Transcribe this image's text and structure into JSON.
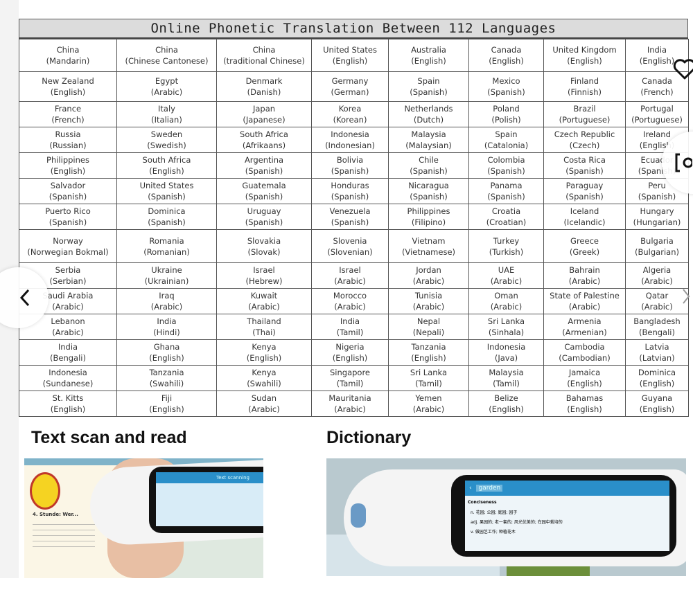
{
  "table": {
    "title": "Online Phonetic Translation Between 112 Languages",
    "rows": [
      [
        [
          "China",
          "(Mandarin)"
        ],
        [
          "China",
          "(Chinese Cantonese)"
        ],
        [
          "China",
          "(traditional Chinese)"
        ],
        [
          "United States",
          "(English)"
        ],
        [
          "Australia",
          "(English)"
        ],
        [
          "Canada",
          "(English)"
        ],
        [
          "United Kingdom",
          "(English)"
        ],
        [
          "India",
          "(English)"
        ]
      ],
      [
        [
          "New Zealand",
          "(English)"
        ],
        [
          "Egypt",
          "(Arabic)"
        ],
        [
          "Denmark",
          "(Danish)"
        ],
        [
          "Germany",
          "(German)"
        ],
        [
          "Spain",
          "(Spanish)"
        ],
        [
          "Mexico",
          "(Spanish)"
        ],
        [
          "Finland",
          "(Finnish)"
        ],
        [
          "Canada",
          "(French)"
        ]
      ],
      [
        [
          "France",
          "(French)"
        ],
        [
          "Italy",
          "(Italian)"
        ],
        [
          "Japan",
          "(Japanese)"
        ],
        [
          "Korea",
          "(Korean)"
        ],
        [
          "Netherlands",
          "(Dutch)"
        ],
        [
          "Poland",
          "(Polish)"
        ],
        [
          "Brazil",
          "(Portuguese)"
        ],
        [
          "Portugal",
          "(Portuguese)"
        ]
      ],
      [
        [
          "Russia",
          "(Russian)"
        ],
        [
          "Sweden",
          "(Swedish)"
        ],
        [
          "South Africa",
          "(Afrikaans)"
        ],
        [
          "Indonesia",
          "(Indonesian)"
        ],
        [
          "Malaysia",
          "(Malaysian)"
        ],
        [
          "Spain",
          "(Catalonia)"
        ],
        [
          "Czech Republic",
          "(Czech)"
        ],
        [
          "Ireland",
          "(English)"
        ]
      ],
      [
        [
          "Philippines",
          "(English)"
        ],
        [
          "South Africa",
          "(English)"
        ],
        [
          "Argentina",
          "(Spanish)"
        ],
        [
          "Bolivia",
          "(Spanish)"
        ],
        [
          "Chile",
          "(Spanish)"
        ],
        [
          "Colombia",
          "(Spanish)"
        ],
        [
          "Costa Rica",
          "(Spanish)"
        ],
        [
          "Ecuador",
          "(Spanish)"
        ]
      ],
      [
        [
          "Salvador",
          "(Spanish)"
        ],
        [
          "United States",
          "(Spanish)"
        ],
        [
          "Guatemala",
          "(Spanish)"
        ],
        [
          "Honduras",
          "(Spanish)"
        ],
        [
          "Nicaragua",
          "(Spanish)"
        ],
        [
          "Panama",
          "(Spanish)"
        ],
        [
          "Paraguay",
          "(Spanish)"
        ],
        [
          "Peru",
          "(Spanish)"
        ]
      ],
      [
        [
          "Puerto Rico",
          "(Spanish)"
        ],
        [
          "Dominica",
          "(Spanish)"
        ],
        [
          "Uruguay",
          "(Spanish)"
        ],
        [
          "Venezuela",
          "(Spanish)"
        ],
        [
          "Philippines",
          "(Filipino)"
        ],
        [
          "Croatia",
          "(Croatian)"
        ],
        [
          "Iceland",
          "(Icelandic)"
        ],
        [
          "Hungary",
          "(Hungarian)"
        ]
      ],
      [
        [
          "Norway",
          "(Norwegian Bokmal)"
        ],
        [
          "Romania",
          "(Romanian)"
        ],
        [
          "Slovakia",
          "(Slovak)"
        ],
        [
          "Slovenia",
          "(Slovenian)"
        ],
        [
          "Vietnam",
          "(Vietnamese)"
        ],
        [
          "Turkey",
          "(Turkish)"
        ],
        [
          "Greece",
          "(Greek)"
        ],
        [
          "Bulgaria",
          "(Bulgarian)"
        ]
      ],
      [
        [
          "Serbia",
          "(Serbian)"
        ],
        [
          "Ukraine",
          "(Ukrainian)"
        ],
        [
          "Israel",
          "(Hebrew)"
        ],
        [
          "Israel",
          "(Arabic)"
        ],
        [
          "Jordan",
          "(Arabic)"
        ],
        [
          "UAE",
          "(Arabic)"
        ],
        [
          "Bahrain",
          "(Arabic)"
        ],
        [
          "Algeria",
          "(Arabic)"
        ]
      ],
      [
        [
          "Saudi Arabia",
          "(Arabic)"
        ],
        [
          "Iraq",
          "(Arabic)"
        ],
        [
          "Kuwait",
          "(Arabic)"
        ],
        [
          "Morocco",
          "(Arabic)"
        ],
        [
          "Tunisia",
          "(Arabic)"
        ],
        [
          "Oman",
          "(Arabic)"
        ],
        [
          "State of Palestine",
          "(Arabic)"
        ],
        [
          "Qatar",
          "(Arabic)"
        ]
      ],
      [
        [
          "Lebanon",
          "(Arabic)"
        ],
        [
          "India",
          "(Hindi)"
        ],
        [
          "Thailand",
          "(Thai)"
        ],
        [
          "India",
          "(Tamil)"
        ],
        [
          "Nepal",
          "(Nepali)"
        ],
        [
          "Sri Lanka",
          "(Sinhala)"
        ],
        [
          "Armenia",
          "(Armenian)"
        ],
        [
          "Bangladesh",
          "(Bengali)"
        ]
      ],
      [
        [
          "India",
          "(Bengali)"
        ],
        [
          "Ghana",
          "(English)"
        ],
        [
          "Kenya",
          "(English)"
        ],
        [
          "Nigeria",
          "(English)"
        ],
        [
          "Tanzania",
          "(English)"
        ],
        [
          "Indonesia",
          "(Java)"
        ],
        [
          "Cambodia",
          "(Cambodian)"
        ],
        [
          "Latvia",
          "(Latvian)"
        ]
      ],
      [
        [
          "Indonesia",
          "(Sundanese)"
        ],
        [
          "Tanzania",
          "(Swahili)"
        ],
        [
          "Kenya",
          "(Swahili)"
        ],
        [
          "Singapore",
          "(Tamil)"
        ],
        [
          "Sri Lanka",
          "(Tamil)"
        ],
        [
          "Malaysia",
          "(Tamil)"
        ],
        [
          "Jamaica",
          "(English)"
        ],
        [
          "Dominica",
          "(English)"
        ]
      ],
      [
        [
          "St. Kitts",
          "(English)"
        ],
        [
          "Fiji",
          "(English)"
        ],
        [
          "Sudan",
          "(Arabic)"
        ],
        [
          "Mauritania",
          "(Arabic)"
        ],
        [
          "Yemen",
          "(Arabic)"
        ],
        [
          "Belize",
          "(English)"
        ],
        [
          "Bahamas",
          "(English)"
        ],
        [
          "Guyana",
          "(English)"
        ]
      ]
    ]
  },
  "sections": {
    "scan": {
      "title": "Text scan and read",
      "screen_text": "Text scanning",
      "book_heading": "4. Stunde: Wer..."
    },
    "dictionary": {
      "title": "Dictionary",
      "search_word": "garden",
      "label": "Conciseness",
      "lines": [
        "n. 花园; 公园; 庭园; 园子",
        "adj. 果园的; 老一套的; 风光优美的; 在园中栽培的",
        "v. 做园艺工作; 种植花木"
      ]
    }
  },
  "overlays": {
    "icons": [
      "heart-icon",
      "scan-icon",
      "chevron-left-icon",
      "chevron-right-icon"
    ]
  },
  "colors": {
    "screen_header": "#2a8fc9",
    "screen_body": "#d8ecf7",
    "title_bg": "#dcdcdc"
  }
}
